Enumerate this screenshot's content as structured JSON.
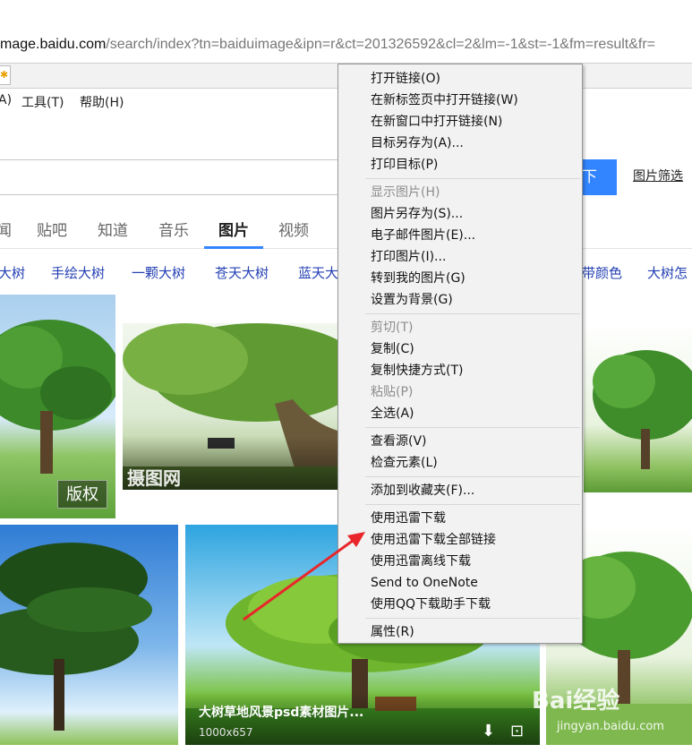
{
  "browser": {
    "url_host": "mage.baidu.com",
    "url_path": "/search/index?tn=baiduimage&ipn=r&ct=201326592&cl=2&lm=-1&st=-1&fm=result&fr=",
    "tab_icon": "page-icon",
    "menu": [
      "A)",
      "工具(T)",
      "帮助(H)"
    ]
  },
  "search": {
    "button_label": "下",
    "filter_label": "图片筛选"
  },
  "nav": {
    "tabs": [
      "闻",
      "贴吧",
      "知道",
      "音乐",
      "图片",
      "视频"
    ],
    "active": "图片"
  },
  "related": [
    "大树",
    "手绘大树",
    "一颗大树",
    "苍天大树",
    "蓝天大",
    "带颜色",
    "大树怎"
  ],
  "images": {
    "copyright_badge": "版权",
    "watermark_text": "摄图网",
    "title": "大树草地风景psd素材图片...",
    "size": "1000x657"
  },
  "context_menu": {
    "items": [
      {
        "label": "打开链接(O)",
        "disabled": false
      },
      {
        "label": "在新标签页中打开链接(W)",
        "disabled": false
      },
      {
        "label": "在新窗口中打开链接(N)",
        "disabled": false
      },
      {
        "label": "目标另存为(A)...",
        "disabled": false
      },
      {
        "label": "打印目标(P)",
        "disabled": false
      },
      {
        "label": "显示图片(H)",
        "disabled": true
      },
      {
        "label": "图片另存为(S)...",
        "disabled": false
      },
      {
        "label": "电子邮件图片(E)...",
        "disabled": false
      },
      {
        "label": "打印图片(I)...",
        "disabled": false
      },
      {
        "label": "转到我的图片(G)",
        "disabled": false
      },
      {
        "label": "设置为背景(G)",
        "disabled": false
      },
      {
        "label": "剪切(T)",
        "disabled": true
      },
      {
        "label": "复制(C)",
        "disabled": false
      },
      {
        "label": "复制快捷方式(T)",
        "disabled": false
      },
      {
        "label": "粘贴(P)",
        "disabled": true
      },
      {
        "label": "全选(A)",
        "disabled": false
      },
      {
        "label": "查看源(V)",
        "disabled": false
      },
      {
        "label": "检查元素(L)",
        "disabled": false
      },
      {
        "label": "添加到收藏夹(F)...",
        "disabled": false
      },
      {
        "label": "使用迅雷下载",
        "disabled": false
      },
      {
        "label": "使用迅雷下载全部链接",
        "disabled": false
      },
      {
        "label": "使用迅雷离线下载",
        "disabled": false
      },
      {
        "label": "Send to OneNote",
        "disabled": false
      },
      {
        "label": "使用QQ下载助手下载",
        "disabled": false
      },
      {
        "label": "属性(R)",
        "disabled": false
      }
    ]
  },
  "annotation": {
    "arrow_color": "#e8262b"
  },
  "watermark": {
    "brand": "Bai经验",
    "url": "jingyan.baidu.com"
  },
  "colors": {
    "accent": "#3385ff",
    "link": "#2440b3"
  }
}
